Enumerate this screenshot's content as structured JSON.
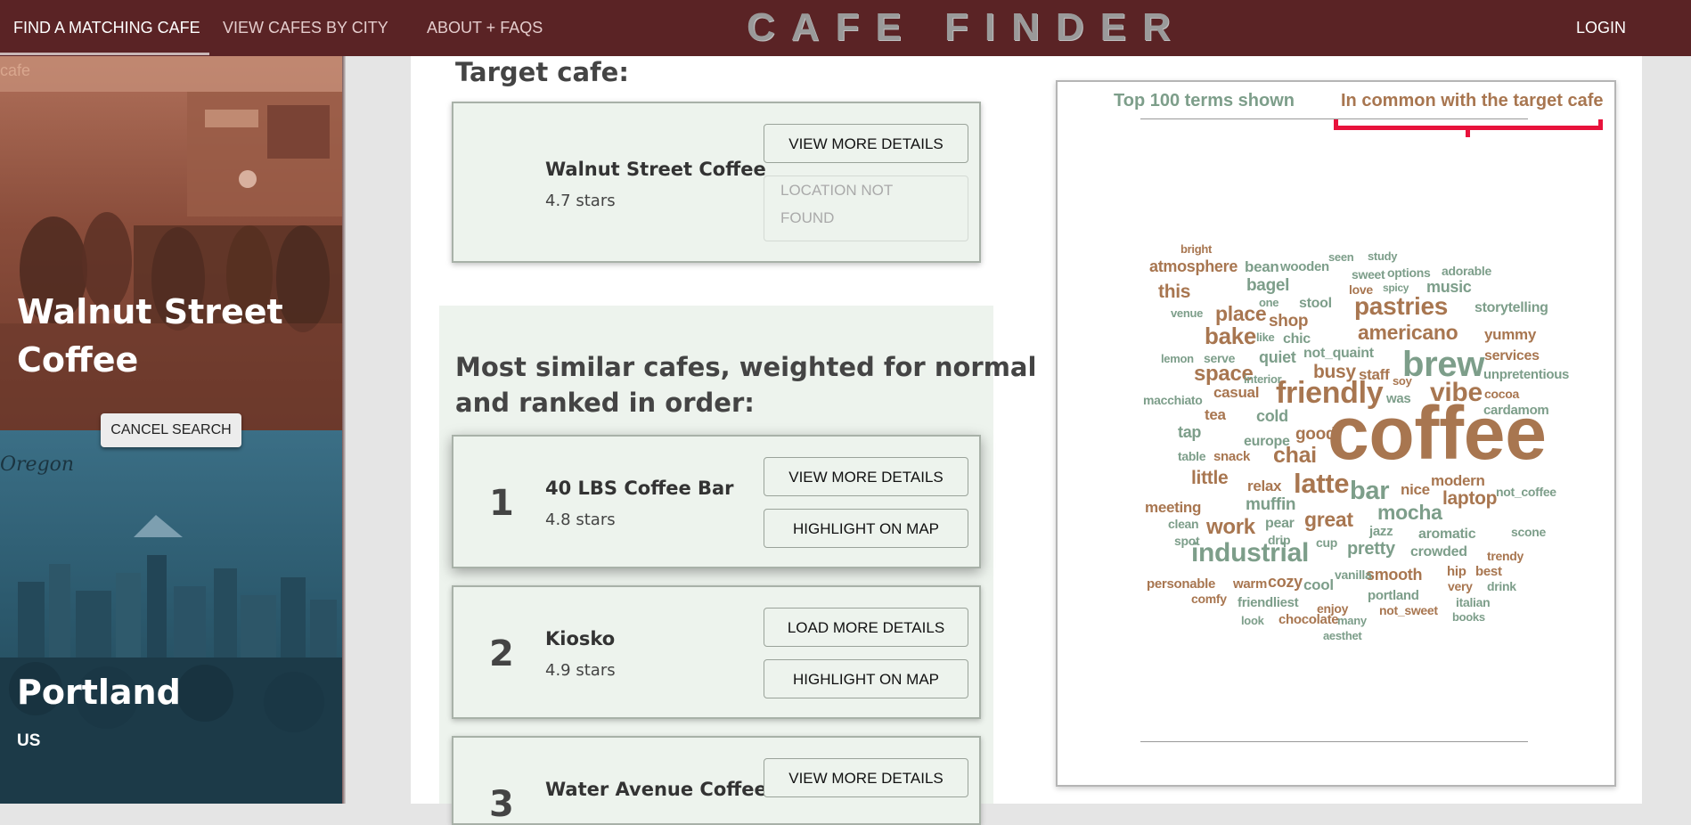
{
  "nav": {
    "find": "FIND A MATCHING CAFE",
    "by_city": "VIEW CAFES BY CITY",
    "about": "ABOUT + FAQS",
    "brand": "CAFE FINDER",
    "login": "LOGIN"
  },
  "left": {
    "img_caption": "cafe",
    "cafe_title": "Walnut Street Coffee",
    "cancel": "CANCEL SEARCH",
    "city_img_text": "Oregon",
    "city_title": "Portland",
    "country": "US"
  },
  "target": {
    "heading": "Target cafe:",
    "name": "Walnut Street Coffee",
    "stars": "4.7 stars",
    "details_btn": "VIEW MORE DETAILS",
    "location_line1": "LOCATION NOT",
    "location_line2": "FOUND"
  },
  "similar": {
    "heading_line1": "Most similar cafes, weighted for normal",
    "heading_line2": "and ranked in order:",
    "cafes": [
      {
        "rank": "1",
        "name": "40 LBS Coffee Bar",
        "stars": "4.8 stars",
        "btn1": "VIEW MORE DETAILS",
        "btn2": "HIGHLIGHT ON MAP"
      },
      {
        "rank": "2",
        "name": "Kiosko",
        "stars": "4.9 stars",
        "btn1": "LOAD MORE DETAILS",
        "btn2": "HIGHLIGHT ON MAP"
      },
      {
        "rank": "3",
        "name": "Water Avenue Coffee",
        "btn1": "VIEW MORE DETAILS"
      }
    ]
  },
  "wordcloud": {
    "left_label": "Top 100 terms shown",
    "right_label": "In common with the target cafe",
    "colors": {
      "common": "#a87650",
      "other": "#7d9e8a"
    },
    "words": [
      "coffee",
      "brew",
      "friendly",
      "latte",
      "industrial",
      "pastries",
      "americano",
      "vibe",
      "bar",
      "bake",
      "space",
      "place",
      "chai",
      "great",
      "work",
      "mocha",
      "laptop",
      "bagel",
      "shop",
      "busy",
      "staff",
      "muffin",
      "pretty",
      "little",
      "good",
      "music",
      "this",
      "atmosphere",
      "storytelling",
      "yummy",
      "smooth",
      "cool",
      "cozy",
      "modern",
      "relax",
      "nice",
      "meeting",
      "crowded",
      "aromatic",
      "quiet",
      "not_quaint",
      "services",
      "unpretentious",
      "casual",
      "cold",
      "tea",
      "europe",
      "tap",
      "snack",
      "portland",
      "friendliest",
      "chocolate",
      "enjoy",
      "not_sweet",
      "italian",
      "books",
      "look",
      "many",
      "aesthet",
      "personable",
      "warm",
      "comfy",
      "vanilla",
      "hip",
      "best",
      "very",
      "drink",
      "trendy",
      "scone",
      "not_coffee",
      "cardamom",
      "cocoa",
      "soy",
      "was",
      "macchiato",
      "interior",
      "lemon",
      "serve",
      "like",
      "chic",
      "stool",
      "venue",
      "one",
      "spicy",
      "love",
      "options",
      "adorable",
      "sweet",
      "seen",
      "study",
      "bean",
      "wooden",
      "bright",
      "table",
      "clean",
      "spot",
      "pear",
      "drip",
      "cup",
      "jazz"
    ]
  }
}
